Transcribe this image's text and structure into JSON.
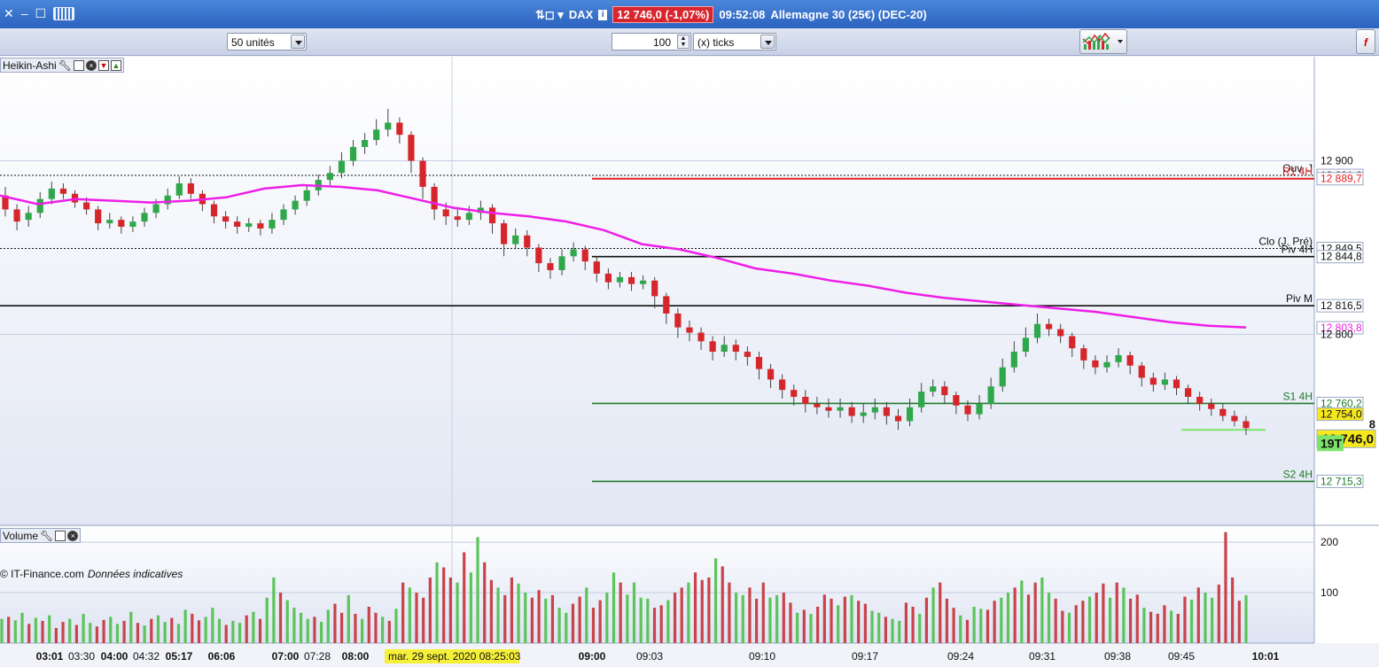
{
  "window": {
    "instrument": "DAX",
    "price_badge": "12 746,0 (-1,07%)",
    "time": "09:52:08",
    "description": "Allemagne 30 (25€) (DEC-20)"
  },
  "toolbar": {
    "units_select": "50 unités",
    "ticks_value": "100",
    "ticks_select": "(x) ticks",
    "right_button": "f"
  },
  "panels": {
    "price_label": "Heikin-Ashi",
    "volume_label": "Volume"
  },
  "footer": {
    "copyright": "© IT-Finance.com",
    "disclaimer": "Données indicatives",
    "date_badge": "mar. 29 sept. 2020 08:25:03"
  },
  "colors": {
    "up": "#2ea84a",
    "down": "#d6262b",
    "ma": "#ee1ee8",
    "resistance": "#e0201f",
    "support": "#1f7a2a",
    "pivot": "#111111",
    "vol_up": "#5cc45a",
    "vol_down": "#c9434a",
    "last_price": "#f7e81d",
    "tick_badge": "#7ee36b"
  },
  "chart_data": [
    {
      "type": "candlestick",
      "style": "Heikin-Ashi",
      "ylim": [
        12690,
        12960
      ],
      "y_ticks": [
        12900,
        12800
      ],
      "y_tick_labels": [
        "12 900",
        "12 800"
      ],
      "x_tick_labels": [
        {
          "label": "03:01",
          "bold": true
        },
        {
          "label": "03:30",
          "bold": false
        },
        {
          "label": "04:00",
          "bold": true
        },
        {
          "label": "04:32",
          "bold": false
        },
        {
          "label": "05:17",
          "bold": true
        },
        {
          "label": "06:06",
          "bold": true
        },
        {
          "label": "07:00",
          "bold": true
        },
        {
          "label": "07:28",
          "bold": false
        },
        {
          "label": "08:00",
          "bold": true
        },
        {
          "label": "09:00",
          "bold": true
        },
        {
          "label": "09:03",
          "bold": false
        },
        {
          "label": "09:10",
          "bold": false
        },
        {
          "label": "09:17",
          "bold": false
        },
        {
          "label": "09:24",
          "bold": false
        },
        {
          "label": "09:31",
          "bold": false
        },
        {
          "label": "09:38",
          "bold": false
        },
        {
          "label": "09:45",
          "bold": false
        },
        {
          "label": "10:01",
          "bold": true
        }
      ],
      "levels": [
        {
          "name": "Ouv. J",
          "value": 12891.6,
          "value_label": "12 891,6",
          "style": "dotted",
          "color": "pivot",
          "from": "start"
        },
        {
          "name": "R1 4H",
          "value": 12889.7,
          "value_label": "12 889,7",
          "style": "solid",
          "color": "resistance",
          "from": "09:00"
        },
        {
          "name": "Clo (J. Pré)",
          "value": 12849.5,
          "value_label": "12 849,5",
          "style": "dotted",
          "color": "pivot",
          "from": "start"
        },
        {
          "name": "Piv 4H",
          "value": 12844.8,
          "value_label": "12 844,8",
          "style": "solid",
          "color": "pivot",
          "from": "09:00"
        },
        {
          "name": "Piv M",
          "value": 12816.5,
          "value_label": "12 816,5",
          "style": "solid",
          "color": "pivot",
          "from": "start"
        },
        {
          "name": "",
          "value": 12803.8,
          "value_label": "12 803,8",
          "style": "ma",
          "color": "ma",
          "from": ""
        },
        {
          "name": "S1 4H",
          "value": 12760.2,
          "value_label": "12 760,2",
          "style": "solid",
          "color": "support",
          "from": "09:00"
        },
        {
          "name": "",
          "value": 12754.0,
          "value_label": "12 754,0",
          "style": "none",
          "color": "last_price",
          "from": ""
        },
        {
          "name": "S2 4H",
          "value": 12715.3,
          "value_label": "12 715,3",
          "style": "solid",
          "color": "support",
          "from": "09:00"
        }
      ],
      "last_price_label": "12 746,0",
      "last_price_value": 12746.0,
      "tick_count_label": "19T",
      "side_label": "8",
      "ma_series": [
        12880,
        12875,
        12878,
        12877,
        12876,
        12877,
        12879,
        12884,
        12886,
        12885,
        12883,
        12878,
        12873,
        12870,
        12868,
        12865,
        12860,
        12852,
        12849,
        12844,
        12838,
        12835,
        12831,
        12828,
        12824,
        12821,
        12819,
        12817,
        12815,
        12813,
        12810,
        12807,
        12805,
        12804
      ],
      "candles": [
        [
          12880,
          12872,
          12885,
          12868
        ],
        [
          12872,
          12865,
          12875,
          12860
        ],
        [
          12866,
          12870,
          12874,
          12862
        ],
        [
          12870,
          12878,
          12882,
          12867
        ],
        [
          12878,
          12884,
          12888,
          12875
        ],
        [
          12884,
          12881,
          12887,
          12878
        ],
        [
          12881,
          12876,
          12883,
          12873
        ],
        [
          12876,
          12872,
          12879,
          12869
        ],
        [
          12872,
          12864,
          12874,
          12860
        ],
        [
          12864,
          12866,
          12870,
          12861
        ],
        [
          12866,
          12862,
          12868,
          12858
        ],
        [
          12862,
          12865,
          12868,
          12859
        ],
        [
          12865,
          12870,
          12873,
          12862
        ],
        [
          12870,
          12875,
          12878,
          12867
        ],
        [
          12875,
          12880,
          12884,
          12872
        ],
        [
          12880,
          12887,
          12891,
          12878
        ],
        [
          12887,
          12881,
          12890,
          12878
        ],
        [
          12881,
          12875,
          12883,
          12871
        ],
        [
          12875,
          12868,
          12877,
          12864
        ],
        [
          12868,
          12865,
          12871,
          12861
        ],
        [
          12865,
          12862,
          12868,
          12858
        ],
        [
          12862,
          12864,
          12867,
          12859
        ],
        [
          12864,
          12861,
          12866,
          12857
        ],
        [
          12861,
          12866,
          12870,
          12858
        ],
        [
          12866,
          12872,
          12875,
          12863
        ],
        [
          12872,
          12877,
          12880,
          12869
        ],
        [
          12877,
          12883,
          12886,
          12874
        ],
        [
          12883,
          12889,
          12892,
          12880
        ],
        [
          12889,
          12893,
          12897,
          12886
        ],
        [
          12893,
          12900,
          12905,
          12890
        ],
        [
          12900,
          12908,
          12912,
          12897
        ],
        [
          12908,
          12912,
          12916,
          12904
        ],
        [
          12912,
          12918,
          12924,
          12909
        ],
        [
          12918,
          12922,
          12930,
          12914
        ],
        [
          12922,
          12915,
          12925,
          12910
        ],
        [
          12915,
          12900,
          12917,
          12893
        ],
        [
          12900,
          12885,
          12902,
          12878
        ],
        [
          12885,
          12872,
          12887,
          12866
        ],
        [
          12872,
          12868,
          12876,
          12863
        ],
        [
          12868,
          12866,
          12872,
          12862
        ],
        [
          12866,
          12870,
          12874,
          12863
        ],
        [
          12870,
          12873,
          12877,
          12866
        ],
        [
          12873,
          12864,
          12875,
          12858
        ],
        [
          12864,
          12852,
          12866,
          12845
        ],
        [
          12852,
          12857,
          12861,
          12849
        ],
        [
          12857,
          12850,
          12860,
          12845
        ],
        [
          12850,
          12841,
          12852,
          12836
        ],
        [
          12841,
          12837,
          12844,
          12832
        ],
        [
          12837,
          12845,
          12849,
          12834
        ],
        [
          12845,
          12849,
          12853,
          12842
        ],
        [
          12849,
          12842,
          12851,
          12837
        ],
        [
          12842,
          12835,
          12845,
          12830
        ],
        [
          12835,
          12830,
          12838,
          12826
        ],
        [
          12830,
          12833,
          12836,
          12827
        ],
        [
          12833,
          12829,
          12836,
          12825
        ],
        [
          12829,
          12831,
          12834,
          12826
        ],
        [
          12831,
          12822,
          12833,
          12815
        ],
        [
          12822,
          12812,
          12824,
          12806
        ],
        [
          12812,
          12804,
          12815,
          12798
        ],
        [
          12804,
          12801,
          12808,
          12796
        ],
        [
          12801,
          12796,
          12804,
          12791
        ],
        [
          12796,
          12790,
          12799,
          12785
        ],
        [
          12790,
          12794,
          12799,
          12787
        ],
        [
          12794,
          12790,
          12797,
          12785
        ],
        [
          12790,
          12787,
          12793,
          12782
        ],
        [
          12787,
          12780,
          12790,
          12774
        ],
        [
          12780,
          12774,
          12783,
          12769
        ],
        [
          12774,
          12768,
          12777,
          12763
        ],
        [
          12768,
          12764,
          12771,
          12759
        ],
        [
          12764,
          12760,
          12768,
          12755
        ],
        [
          12760,
          12758,
          12764,
          12754
        ],
        [
          12758,
          12756,
          12763,
          12752
        ],
        [
          12756,
          12758,
          12763,
          12752
        ],
        [
          12758,
          12753,
          12761,
          12749
        ],
        [
          12753,
          12755,
          12760,
          12749
        ],
        [
          12755,
          12758,
          12763,
          12751
        ],
        [
          12758,
          12753,
          12761,
          12748
        ],
        [
          12753,
          12750,
          12757,
          12745
        ],
        [
          12750,
          12758,
          12763,
          12747
        ],
        [
          12758,
          12767,
          12772,
          12755
        ],
        [
          12767,
          12770,
          12774,
          12764
        ],
        [
          12770,
          12765,
          12773,
          12760
        ],
        [
          12765,
          12759,
          12767,
          12754
        ],
        [
          12759,
          12754,
          12762,
          12750
        ],
        [
          12754,
          12760,
          12765,
          12751
        ],
        [
          12760,
          12770,
          12775,
          12757
        ],
        [
          12770,
          12781,
          12786,
          12767
        ],
        [
          12781,
          12790,
          12796,
          12778
        ],
        [
          12790,
          12798,
          12804,
          12787
        ],
        [
          12798,
          12806,
          12812,
          12795
        ],
        [
          12806,
          12803,
          12809,
          12799
        ],
        [
          12803,
          12799,
          12806,
          12795
        ],
        [
          12799,
          12792,
          12801,
          12787
        ],
        [
          12792,
          12785,
          12794,
          12780
        ],
        [
          12785,
          12781,
          12788,
          12777
        ],
        [
          12781,
          12784,
          12788,
          12778
        ],
        [
          12784,
          12788,
          12792,
          12781
        ],
        [
          12788,
          12782,
          12790,
          12777
        ],
        [
          12782,
          12775,
          12784,
          12770
        ],
        [
          12775,
          12771,
          12778,
          12767
        ],
        [
          12771,
          12774,
          12778,
          12768
        ],
        [
          12774,
          12769,
          12776,
          12765
        ],
        [
          12769,
          12764,
          12771,
          12760
        ],
        [
          12764,
          12760,
          12767,
          12756
        ],
        [
          12760,
          12757,
          12763,
          12753
        ],
        [
          12757,
          12753,
          12760,
          12750
        ],
        [
          12753,
          12750,
          12756,
          12747
        ],
        [
          12750,
          12746,
          12753,
          12742
        ]
      ]
    },
    {
      "type": "bar",
      "title": "Volume",
      "ylim": [
        0,
        230
      ],
      "y_ticks": [
        200,
        100
      ],
      "y_tick_labels": [
        "200",
        "100"
      ],
      "values": [
        48,
        52,
        45,
        60,
        38,
        50,
        44,
        55,
        30,
        42,
        48,
        36,
        58,
        40,
        33,
        46,
        52,
        38,
        44,
        62,
        40,
        35,
        48,
        55,
        42,
        50,
        38,
        66,
        58,
        45,
        52,
        70,
        48,
        36,
        44,
        40,
        55,
        62,
        48,
        90,
        130,
        100,
        85,
        70,
        60,
        48,
        52,
        42,
        66,
        78,
        60,
        95,
        58,
        48,
        72,
        60,
        52,
        44,
        68,
        120,
        110,
        100,
        90,
        130,
        160,
        150,
        130,
        120,
        180,
        140,
        210,
        160,
        125,
        110,
        95,
        130,
        118,
        100,
        90,
        105,
        88,
        95,
        70,
        60,
        78,
        92,
        110,
        70,
        85,
        100,
        140,
        120,
        96,
        120,
        90,
        88,
        70,
        75,
        85,
        100,
        110,
        120,
        140,
        125,
        130,
        168,
        152,
        120,
        100,
        95,
        110,
        88,
        120,
        90,
        95,
        100,
        80,
        60,
        66,
        58,
        72,
        96,
        88,
        75,
        92,
        95,
        84,
        78,
        64,
        60,
        52,
        48,
        44,
        80,
        72,
        58,
        90,
        110,
        120,
        88,
        70,
        55,
        46,
        72,
        68,
        66,
        84,
        90,
        100,
        110,
        124,
        96,
        120,
        130,
        100,
        88,
        64,
        60,
        75,
        84,
        92,
        100,
        118,
        90,
        120,
        110,
        88,
        96,
        70,
        62,
        58,
        75,
        64,
        58,
        92,
        86,
        110,
        100,
        90,
        116,
        220,
        130,
        84,
        95
      ],
      "up_flags": [
        1,
        0,
        1,
        1,
        0,
        1,
        0,
        1,
        0,
        0,
        1,
        0,
        1,
        1,
        0,
        0,
        1,
        1,
        0,
        1,
        0,
        1,
        0,
        1,
        1,
        0,
        1,
        1,
        0,
        0,
        1,
        1,
        1,
        0,
        1,
        1,
        0,
        1,
        0,
        1,
        1,
        0,
        1,
        1,
        1,
        1,
        0,
        1,
        1,
        0,
        0,
        1,
        0,
        1,
        0,
        0,
        1,
        0,
        1,
        0,
        1,
        0,
        0,
        0,
        1,
        0,
        0,
        1,
        0,
        1,
        1,
        0,
        0,
        1,
        0,
        0,
        1,
        1,
        0,
        0,
        1,
        0,
        1,
        1,
        0,
        0,
        1,
        0,
        0,
        1,
        1,
        0,
        1,
        1,
        1,
        1,
        0,
        0,
        1,
        0,
        0,
        1,
        0,
        0,
        0,
        1,
        0,
        0,
        1,
        1,
        0,
        0,
        0,
        1,
        1,
        0,
        0,
        1,
        0,
        1,
        0,
        0,
        0,
        1,
        0,
        1,
        0,
        0,
        1,
        1,
        0,
        1,
        1,
        0,
        0,
        1,
        0,
        1,
        0,
        0,
        0,
        1,
        0,
        1,
        1,
        0,
        0,
        1,
        1,
        0,
        1,
        0,
        0,
        1,
        1,
        0,
        0,
        1,
        0,
        0,
        1,
        0,
        0,
        1,
        0,
        1,
        0,
        0,
        1,
        0,
        0,
        0,
        1,
        0,
        0,
        1,
        0,
        1,
        1,
        0,
        0,
        0,
        0,
        1
      ]
    }
  ]
}
